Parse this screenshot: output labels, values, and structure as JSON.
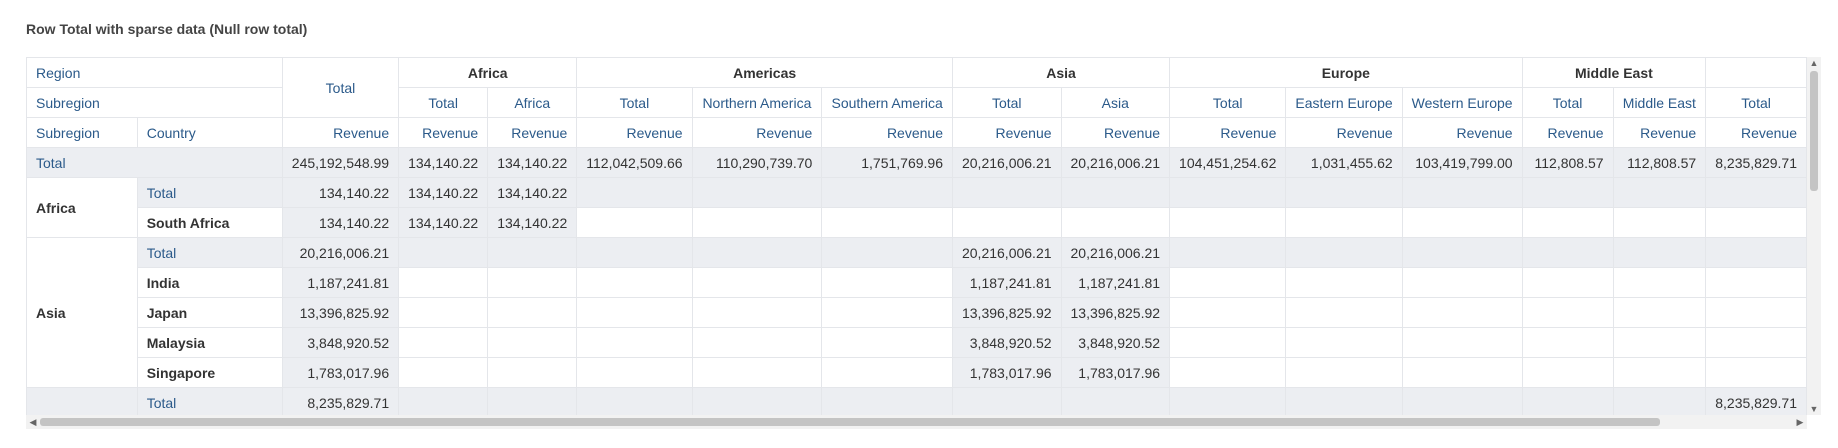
{
  "title": "Row Total with sparse data (Null row total)",
  "header": {
    "region_label": "Region",
    "subregion_label": "Subregion",
    "subregion_col_label": "Subregion",
    "country_label": "Country",
    "total_main": "Total",
    "regions": [
      "Africa",
      "Americas",
      "Asia",
      "Europe",
      "Middle East"
    ],
    "subcols": [
      "Total",
      "Africa",
      "Total",
      "Northern America",
      "Southern America",
      "Total",
      "Asia",
      "Total",
      "Eastern Europe",
      "Western Europe",
      "Total",
      "Middle East",
      "Total"
    ],
    "measure": "Revenue"
  },
  "rows": {
    "grand_total": {
      "label": "Total",
      "values": [
        "245,192,548.99",
        "134,140.22",
        "134,140.22",
        "112,042,509.66",
        "110,290,739.70",
        "1,751,769.96",
        "20,216,006.21",
        "20,216,006.21",
        "104,451,254.62",
        "1,031,455.62",
        "103,419,799.00",
        "112,808.57",
        "112,808.57",
        "8,235,829.71"
      ]
    },
    "africa": {
      "region": "Africa",
      "total": {
        "label": "Total",
        "values": [
          "134,140.22",
          "134,140.22",
          "134,140.22",
          "",
          "",
          "",
          "",
          "",
          "",
          "",
          "",
          "",
          "",
          ""
        ]
      },
      "countries": [
        {
          "label": "South Africa",
          "values": [
            "134,140.22",
            "134,140.22",
            "134,140.22",
            "",
            "",
            "",
            "",
            "",
            "",
            "",
            "",
            "",
            "",
            ""
          ]
        }
      ]
    },
    "asia": {
      "region": "Asia",
      "total": {
        "label": "Total",
        "values": [
          "20,216,006.21",
          "",
          "",
          "",
          "",
          "",
          "20,216,006.21",
          "20,216,006.21",
          "",
          "",
          "",
          "",
          "",
          ""
        ]
      },
      "countries": [
        {
          "label": "India",
          "values": [
            "1,187,241.81",
            "",
            "",
            "",
            "",
            "",
            "1,187,241.81",
            "1,187,241.81",
            "",
            "",
            "",
            "",
            "",
            ""
          ]
        },
        {
          "label": "Japan",
          "values": [
            "13,396,825.92",
            "",
            "",
            "",
            "",
            "",
            "13,396,825.92",
            "13,396,825.92",
            "",
            "",
            "",
            "",
            "",
            ""
          ]
        },
        {
          "label": "Malaysia",
          "values": [
            "3,848,920.52",
            "",
            "",
            "",
            "",
            "",
            "3,848,920.52",
            "3,848,920.52",
            "",
            "",
            "",
            "",
            "",
            ""
          ]
        },
        {
          "label": "Singapore",
          "values": [
            "1,783,017.96",
            "",
            "",
            "",
            "",
            "",
            "1,783,017.96",
            "1,783,017.96",
            "",
            "",
            "",
            "",
            "",
            ""
          ]
        }
      ]
    },
    "next_total": {
      "label": "Total",
      "values": [
        "8,235,829.71",
        "",
        "",
        "",
        "",
        "",
        "",
        "",
        "",
        "",
        "",
        "",
        "",
        "8,235,829.71"
      ]
    }
  }
}
